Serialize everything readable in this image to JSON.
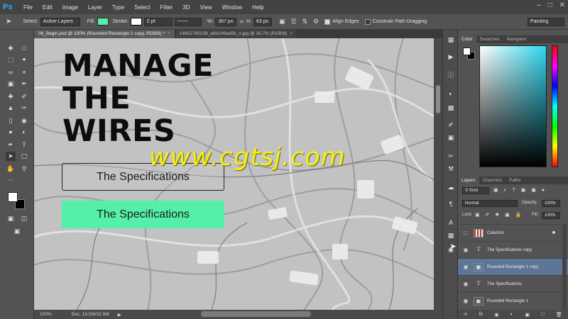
{
  "app": {
    "logo": "Ps"
  },
  "menu": [
    "File",
    "Edit",
    "Image",
    "Layer",
    "Type",
    "Select",
    "Filter",
    "3D",
    "View",
    "Window",
    "Help"
  ],
  "options": {
    "select_label": "Select:",
    "select_value": "Active Layers",
    "fill_label": "Fill:",
    "stroke_label": "Stroke:",
    "stroke_value": "0 pt",
    "w_label": "W:",
    "w_value": "367 px",
    "h_label": "H:",
    "h_value": "63 px",
    "align_edges": "Align Edges",
    "constrain": "Constrain Path Dragging",
    "workspace": "Painting"
  },
  "tabs": [
    {
      "label": "06_Begin.psd @ 100% (Rounded Rectangle 1 copy, RGB/8) *",
      "active": true
    },
    {
      "label": "14452760238_a6d146aa5b_o.jpg @ 16.7% (RGB/8)",
      "active": false
    }
  ],
  "canvas": {
    "headline": [
      "MANAGE",
      "THE",
      "WIRES"
    ],
    "button_outline": "The Specifications",
    "button_filled": "The Specifications",
    "watermark": "www.cgtsj.com"
  },
  "status": {
    "zoom": "100%",
    "doc": "Doc: 16.5M/32.6M"
  },
  "color_panel": {
    "tabs": [
      "Color",
      "Swatches",
      "Navigator"
    ]
  },
  "layers_panel": {
    "tabs": [
      "Layers",
      "Channels",
      "Paths"
    ],
    "kind": "Kind",
    "blend": "Normal",
    "opacity_label": "Opacity:",
    "opacity_value": "100%",
    "lock_label": "Lock:",
    "fill_label": "Fill:",
    "fill_value": "100%",
    "layers": [
      {
        "name": "Columns",
        "type": "group",
        "selected": false,
        "locked": true
      },
      {
        "name": "The Specifications copy",
        "type": "text",
        "selected": false
      },
      {
        "name": "Rounded Rectangle 1 copy",
        "type": "shape",
        "selected": true
      },
      {
        "name": "The Specifications",
        "type": "text",
        "selected": false
      },
      {
        "name": "Rounded Rectangle 1",
        "type": "shape",
        "selected": false
      }
    ]
  },
  "colors": {
    "accent_green": "#54f0a9",
    "watermark_yellow": "#f6ee16",
    "selected_layer": "#5d7597"
  }
}
